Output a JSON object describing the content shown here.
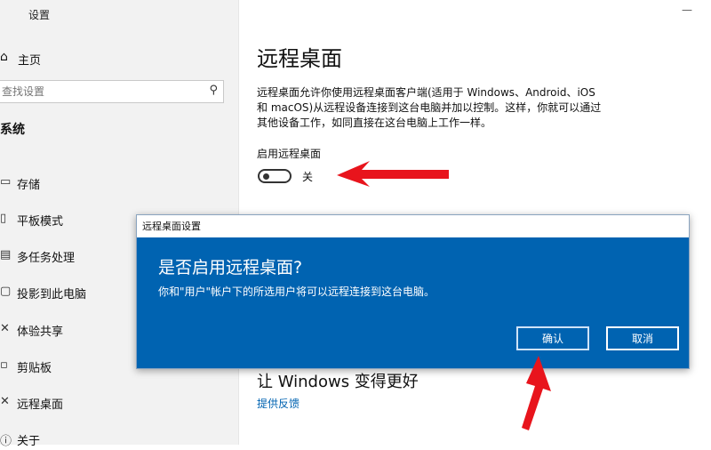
{
  "window": {
    "title": "设置",
    "minimize_glyph": "—"
  },
  "sidebar": {
    "home_label": "主页",
    "search_placeholder": "查找设置",
    "section_title": "系统",
    "items": [
      {
        "label": "存储",
        "icon": "storage-icon"
      },
      {
        "label": "平板模式",
        "icon": "tablet-mode-icon"
      },
      {
        "label": "多任务处理",
        "icon": "multitasking-icon"
      },
      {
        "label": "投影到此电脑",
        "icon": "projecting-icon"
      },
      {
        "label": "体验共享",
        "icon": "shared-experiences-icon"
      },
      {
        "label": "剪贴板",
        "icon": "clipboard-icon"
      },
      {
        "label": "远程桌面",
        "icon": "remote-desktop-icon"
      },
      {
        "label": "关于",
        "icon": "about-icon"
      }
    ]
  },
  "main": {
    "title": "远程桌面",
    "description_lines": [
      "远程桌面允许你使用远程桌面客户端(适用于 Windows、Android、iOS",
      "和 macOS)从远程设备连接到这台电脑并加以控制。这样，你就可以通过",
      "其他设备工作，如同直接在这台电脑上工作一样。"
    ],
    "toggle_label": "启用远程桌面",
    "toggle_state": "关",
    "toggle_on": false,
    "subheading": "让 Windows 变得更好",
    "feedback_link": "提供反馈"
  },
  "dialog": {
    "title": "远程桌面设置",
    "heading": "是否启用远程桌面?",
    "message": "你和\"用户\"帐户下的所选用户将可以远程连接到这台电脑。",
    "confirm_label": "确认",
    "cancel_label": "取消",
    "background_color": "#0063b1"
  },
  "annotations": {
    "arrow_color": "#e8141c"
  }
}
